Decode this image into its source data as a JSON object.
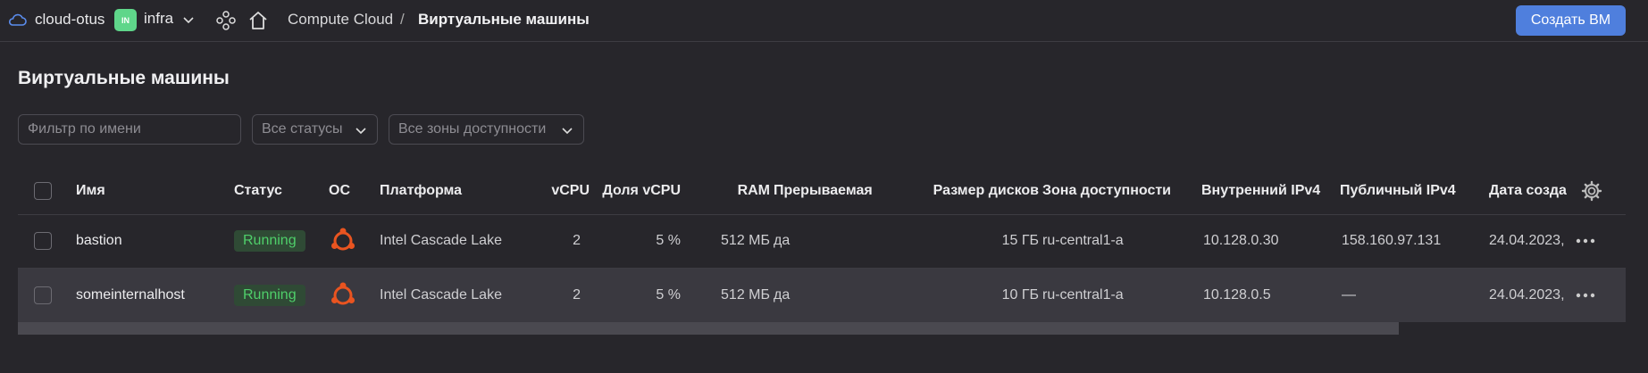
{
  "header": {
    "cloud_name": "cloud-otus",
    "folder_badge": "IN",
    "folder_name": "infra",
    "breadcrumb_service": "Compute Cloud",
    "breadcrumb_separator": "/",
    "breadcrumb_current": "Виртуальные машины",
    "create_button": "Создать ВМ"
  },
  "page": {
    "title": "Виртуальные машины"
  },
  "filters": {
    "name_placeholder": "Фильтр по имени",
    "status_selected": "Все статусы",
    "zone_selected": "Все зоны доступности"
  },
  "table": {
    "columns": {
      "name": "Имя",
      "status": "Статус",
      "os": "ОС",
      "platform": "Платформа",
      "vcpu": "vCPU",
      "vcpu_share": "Доля vCPU",
      "ram": "RAM",
      "preemptible": "Прерываемая",
      "disk_size": "Размер дисков",
      "zone": "Зона доступности",
      "internal_ipv4": "Внутренний IPv4",
      "public_ipv4": "Публичный IPv4",
      "created": "Дата создания"
    },
    "rows": [
      {
        "name": "bastion",
        "status": "Running",
        "os": "ubuntu-icon",
        "platform": "Intel Cascade Lake",
        "vcpu": "2",
        "vcpu_share": "5 %",
        "ram": "512 МБ",
        "preemptible": "да",
        "disk_size": "15 ГБ",
        "zone": "ru-central1-a",
        "internal_ipv4": "10.128.0.30",
        "public_ipv4": "158.160.97.131",
        "created": "24.04.2023,"
      },
      {
        "name": "someinternalhost",
        "status": "Running",
        "os": "ubuntu-icon",
        "platform": "Intel Cascade Lake",
        "vcpu": "2",
        "vcpu_share": "5 %",
        "ram": "512 МБ",
        "preemptible": "да",
        "disk_size": "10 ГБ",
        "zone": "ru-central1-a",
        "internal_ipv4": "10.128.0.5",
        "public_ipv4": "—",
        "created": "24.04.2023,"
      }
    ]
  },
  "colors": {
    "background": "#27262b",
    "accent": "#4f7fdd",
    "status_running": "#4fcf6a",
    "ubuntu": "#e95420"
  }
}
